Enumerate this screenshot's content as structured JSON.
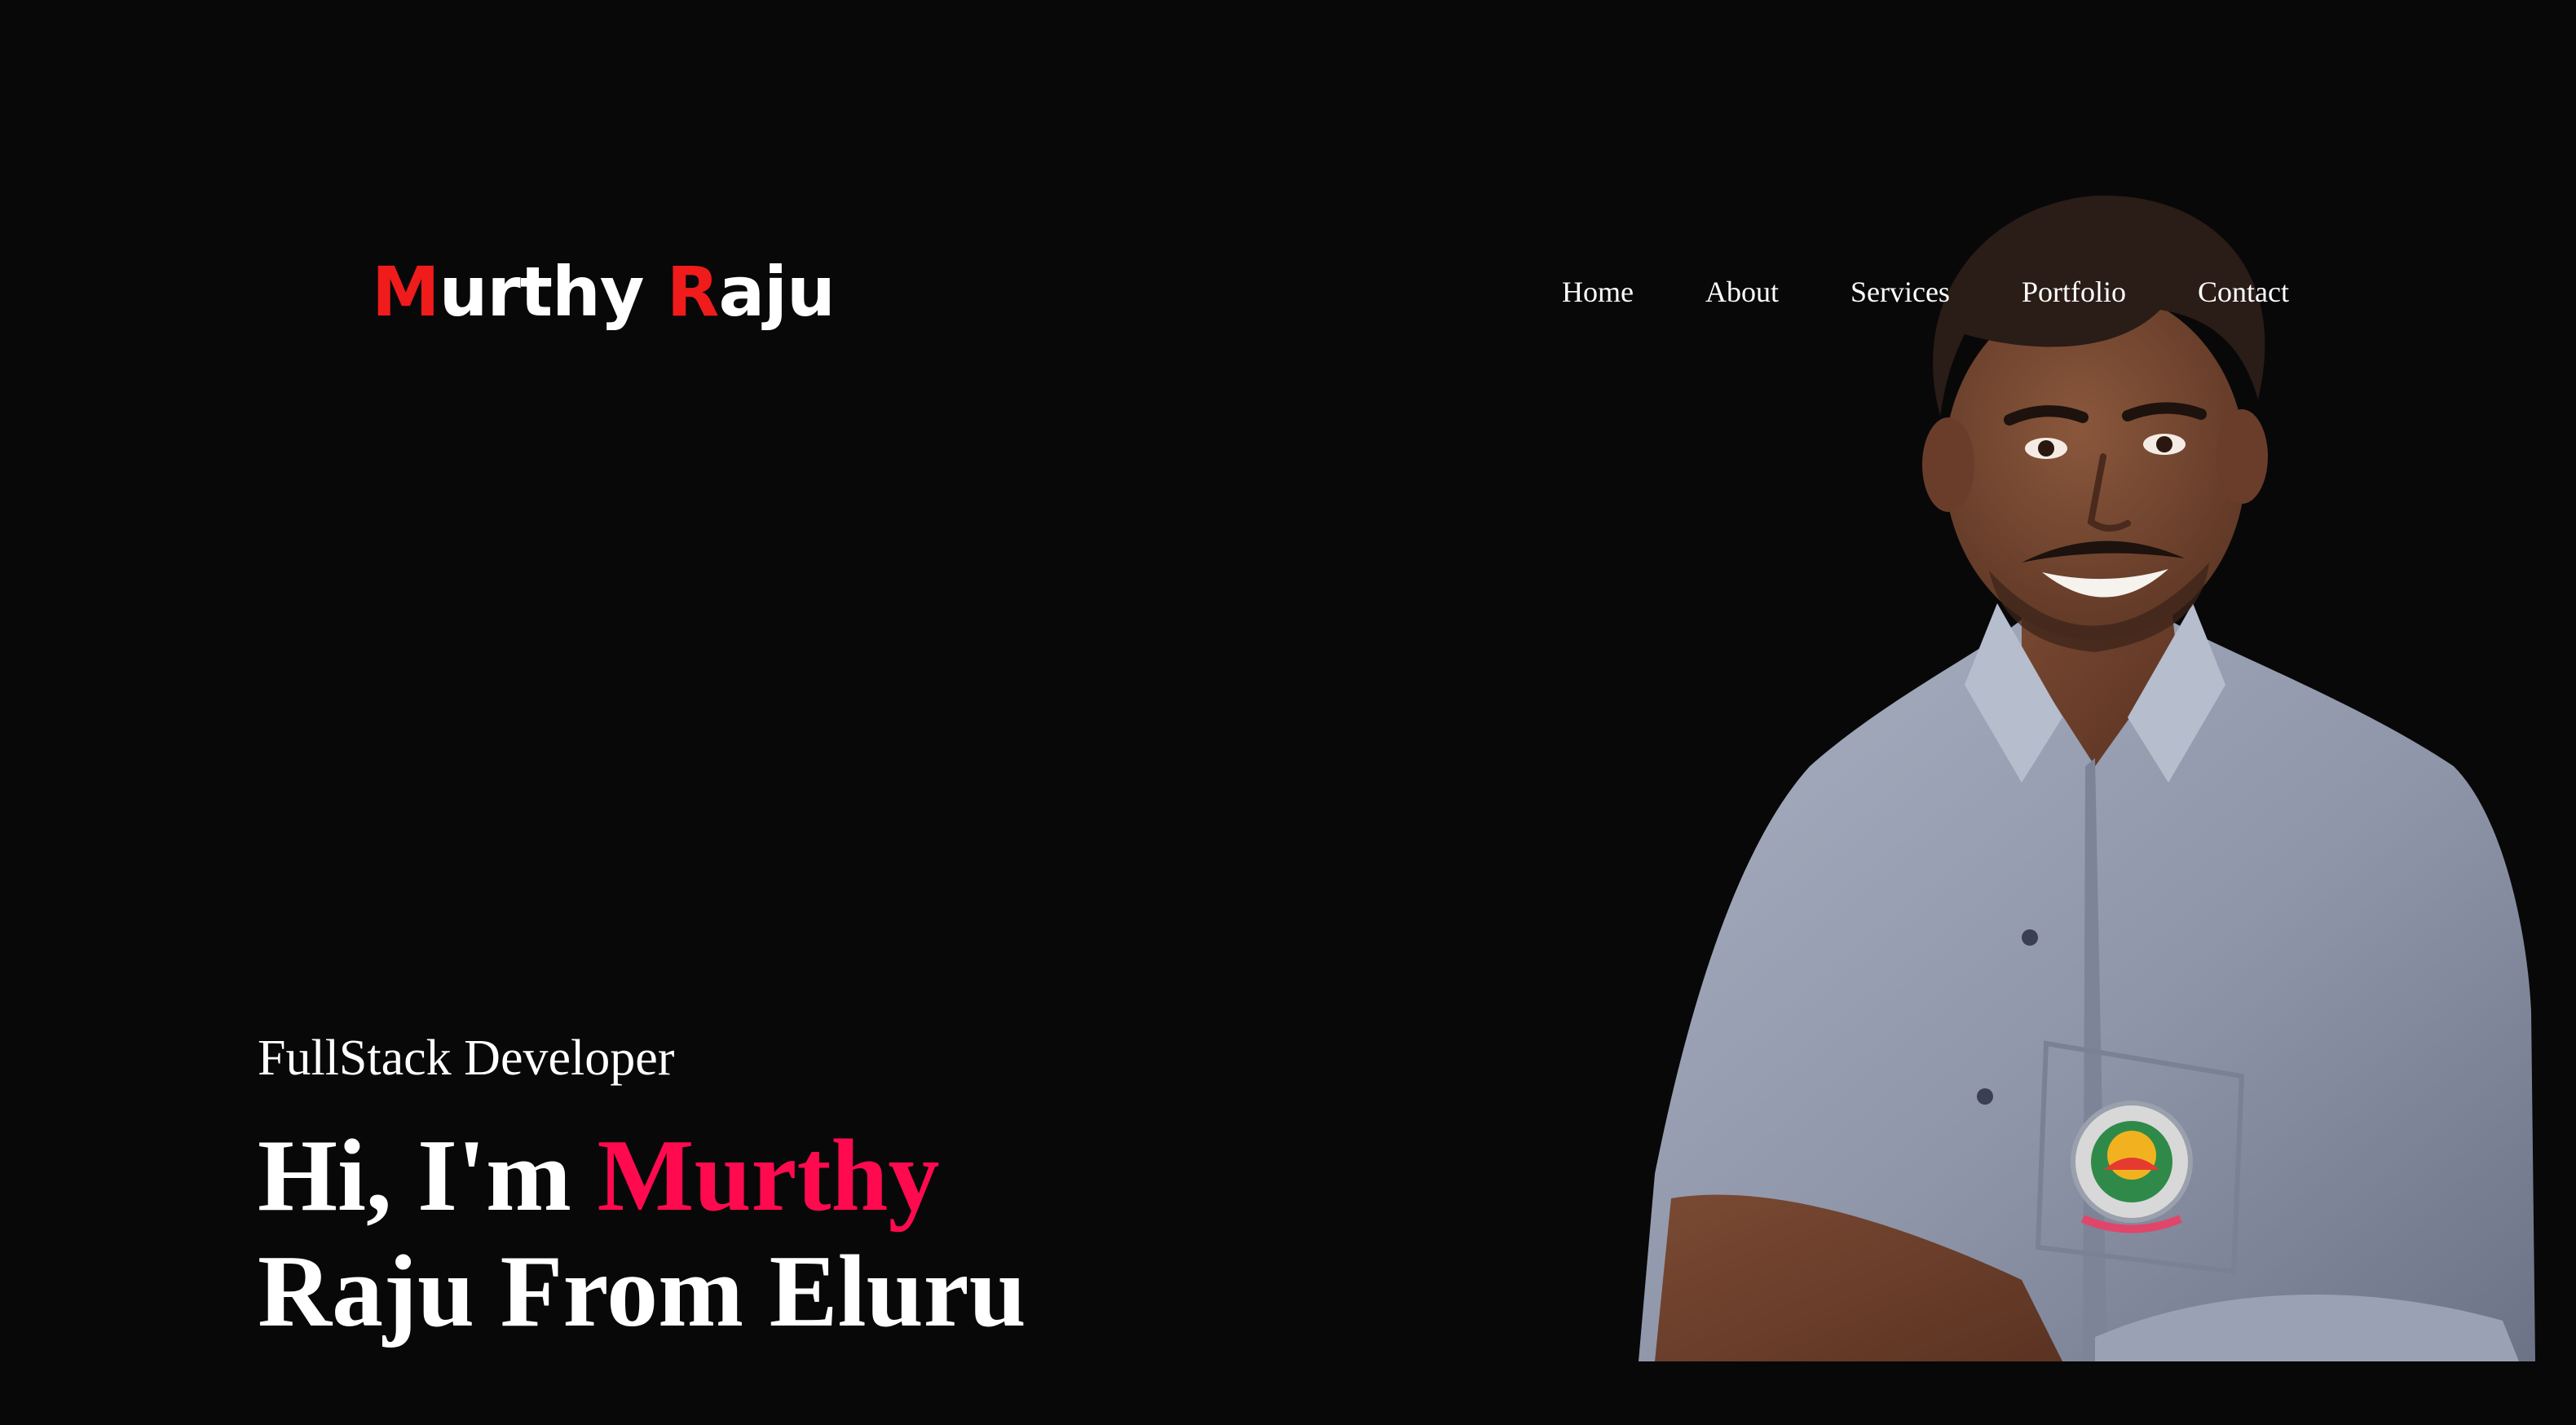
{
  "header": {
    "logo": {
      "first_initial": "M",
      "first_rest": "urthy ",
      "second_initial": "R",
      "second_rest": "aju"
    },
    "nav": [
      {
        "label": "Home"
      },
      {
        "label": "About"
      },
      {
        "label": "Services"
      },
      {
        "label": "Portfolio"
      },
      {
        "label": "Contact"
      }
    ]
  },
  "hero": {
    "role": "FullStack Developer",
    "greeting_prefix": "Hi, I'm ",
    "greeting_name": "Murthy",
    "greeting_suffix": "Raju From Eluru"
  },
  "colors": {
    "background": "#080809",
    "logo_accent": "#f01b1b",
    "name_accent": "#ff0a4f",
    "text": "#ffffff"
  }
}
